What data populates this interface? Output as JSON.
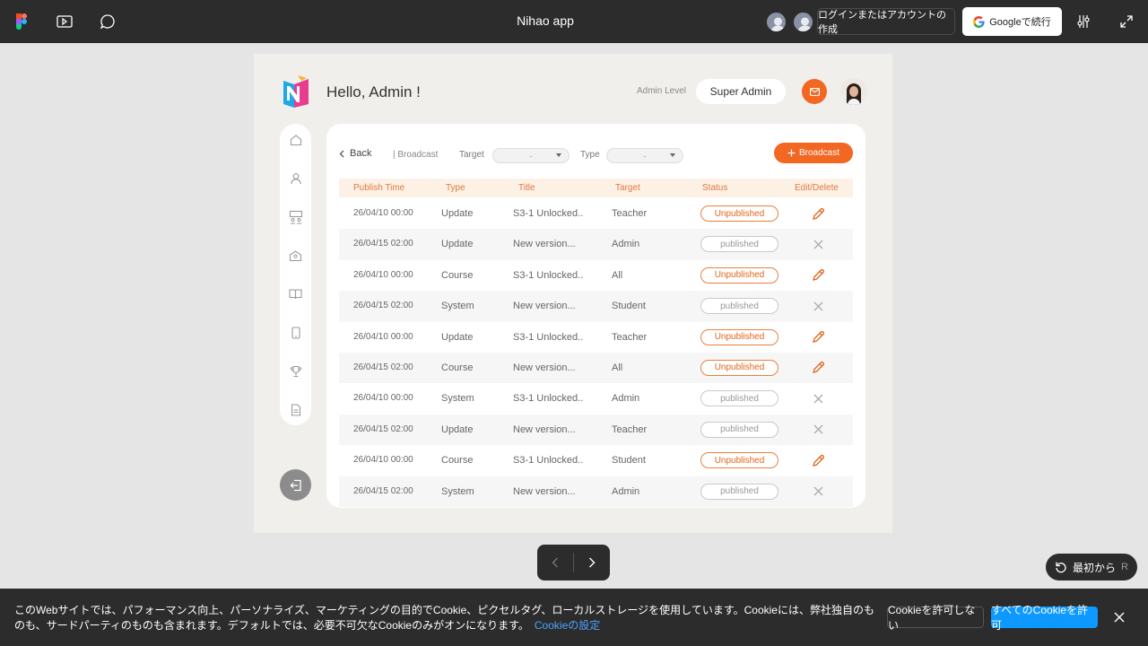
{
  "topbar": {
    "title": "Nihao app",
    "login_label": "ログインまたはアカウントの作成",
    "google_label": "Googleで続行",
    "icons": [
      "figma-logo-icon",
      "present-icon",
      "comment-icon",
      "settings-sliders-icon",
      "fullscreen-icon"
    ]
  },
  "app": {
    "greeting": "Hello, Admin !",
    "admin_level_label": "Admin Level",
    "admin_level_value": "Super Admin",
    "accent": "#f26722"
  },
  "toolbar": {
    "back_label": "Back",
    "breadcrumb": "| Broadcast",
    "target_label": "Target",
    "target_value": "-",
    "type_label": "Type",
    "type_value": "-",
    "broadcast_label": "Broadcast"
  },
  "table": {
    "headers": [
      "Publish Time",
      "Type",
      "Title",
      "Target",
      "Status",
      "Edit/Delete"
    ],
    "rows": [
      {
        "time": "26/04/10 00:00",
        "type": "Update",
        "title": "S3-1 Unlocked..",
        "target": "Teacher",
        "status": "Unpublished",
        "action": "edit"
      },
      {
        "time": "26/04/15 02:00",
        "type": "Update",
        "title": "New version...",
        "target": "Admin",
        "status": "published",
        "action": "delete"
      },
      {
        "time": "26/04/10 00:00",
        "type": "Course",
        "title": "S3-1 Unlocked..",
        "target": "All",
        "status": "Unpublished",
        "action": "edit"
      },
      {
        "time": "26/04/15 02:00",
        "type": "System",
        "title": "New version...",
        "target": "Student",
        "status": "published",
        "action": "delete"
      },
      {
        "time": "26/04/10 00:00",
        "type": "Update",
        "title": "S3-1 Unlocked..",
        "target": "Teacher",
        "status": "Unpublished",
        "action": "edit"
      },
      {
        "time": "26/04/15 02:00",
        "type": "Course",
        "title": "New version...",
        "target": "All",
        "status": "Unpublished",
        "action": "edit"
      },
      {
        "time": "26/04/10 00:00",
        "type": "System",
        "title": "S3-1 Unlocked..",
        "target": "Admin",
        "status": "published",
        "action": "delete"
      },
      {
        "time": "26/04/15 02:00",
        "type": "Update",
        "title": "New version...",
        "target": "Teacher",
        "status": "published",
        "action": "delete"
      },
      {
        "time": "26/04/10 00:00",
        "type": "Course",
        "title": "S3-1 Unlocked..",
        "target": "Student",
        "status": "Unpublished",
        "action": "edit"
      },
      {
        "time": "26/04/15 02:00",
        "type": "System",
        "title": "New version...",
        "target": "Admin",
        "status": "published",
        "action": "delete"
      }
    ]
  },
  "player": {
    "restart_label": "最初から",
    "restart_key": "R"
  },
  "cookie": {
    "text": "このWebサイトでは、パフォーマンス向上、パーソナライズ、マーケティングの目的でCookie、ピクセルタグ、ローカルストレージを使用しています。Cookieには、弊社独自のものも、サードパーティのものも含まれます。デフォルトでは、必要不可欠なCookieのみがオンになります。",
    "settings_link": "Cookieの設定",
    "deny_label": "Cookieを許可しない",
    "allow_label": "すべてのCookieを許可"
  }
}
